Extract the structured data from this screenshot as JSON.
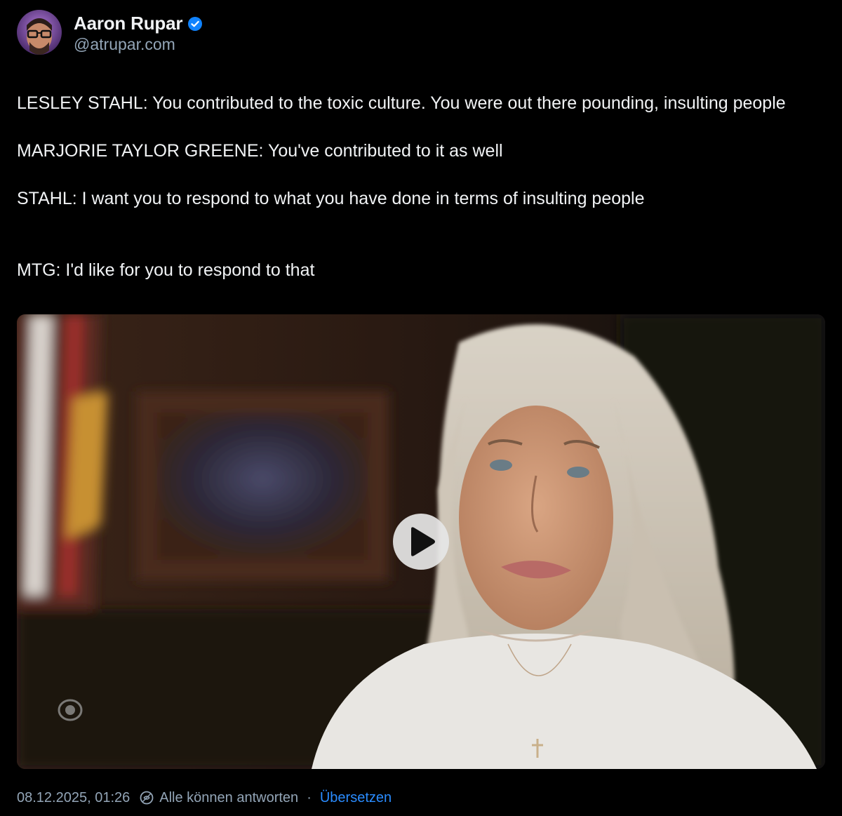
{
  "post": {
    "author": {
      "display_name": "Aaron Rupar",
      "handle": "@atrupar.com",
      "verified": true
    },
    "text": {
      "paragraph_1": "LESLEY STAHL: You contributed to the toxic culture. You were out there pounding, insulting people",
      "paragraph_2": "MARJORIE TAYLOR GREENE: You've contributed to it as well",
      "paragraph_3": "STAHL: I want you to respond to what you have done in terms of insulting people",
      "paragraph_4": "MTG: I'd like for you to respond to that"
    },
    "media": {
      "type": "video",
      "play_icon": "play-icon",
      "watermark_icon": "cbs-eye-logo-icon"
    },
    "footer": {
      "timestamp": "08.12.2025, 01:26",
      "reply_setting": "Alle können antworten",
      "separator": "·",
      "translate_label": "Übersetzen"
    }
  },
  "colors": {
    "background": "#000000",
    "text": "#f1f3f5",
    "muted": "#93a5b7",
    "link": "#2a8cff",
    "verified_badge": "#1083fe"
  }
}
